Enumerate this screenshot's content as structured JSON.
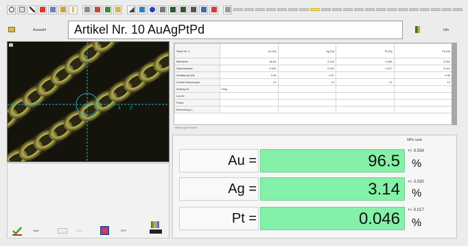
{
  "header": {
    "left_label": "Auswahl",
    "title": "Artikel Nr. 10  AuAgPtPd",
    "right_label": "Info"
  },
  "image": {
    "scale_labels": [
      "1",
      "2"
    ]
  },
  "table": {
    "columns": [
      "Stück Nr.  1",
      "Au [%]",
      "Ag [%]",
      "Pt [%]",
      "Pd [%]"
    ],
    "rows": [
      {
        "label": "Mittelwert",
        "values": [
          "96.50",
          "3.142",
          "0.046",
          "0.264"
        ]
      },
      {
        "label": "Standardabw.",
        "values": [
          "0.034",
          "0.031",
          "0.017",
          "0.024"
        ]
      },
      {
        "label": "Variationsk.[%]",
        "values": [
          "0.36",
          "0.97",
          "",
          "0.95"
        ]
      },
      {
        "label": "Anzahl Messungen",
        "values": [
          "12",
          "12",
          "12",
          "12"
        ]
      },
      {
        "label": "Auftrag Nr.",
        "values": [
          "Ring",
          "",
          "",
          ""
        ]
      },
      {
        "label": "Los Nr.",
        "values": [
          "",
          "",
          "",
          ""
        ]
      },
      {
        "label": "Prüfer",
        "values": [
          "",
          "",
          "",
          ""
        ]
      },
      {
        "label": "Bemerkung 1",
        "values": [
          "",
          "",
          "",
          ""
        ]
      }
    ],
    "status": "Messung beendet"
  },
  "footer": {
    "start_label": "Start",
    "edit_label": "Edit",
    "off_label": "OFF"
  },
  "results": {
    "note": "68% rand.",
    "items": [
      {
        "element": "Au =",
        "value": "96.5",
        "deviation": "+/- 0.034",
        "unit": "%"
      },
      {
        "element": "Ag =",
        "value": "3.14",
        "deviation": "+/- 0.030",
        "unit": "%"
      },
      {
        "element": "Pt =",
        "value": "0.046",
        "deviation": "+/- 0.017",
        "unit": "%"
      }
    ]
  },
  "colors": {
    "value_background": "#84f0a8",
    "crosshair": "#23b5c8"
  }
}
